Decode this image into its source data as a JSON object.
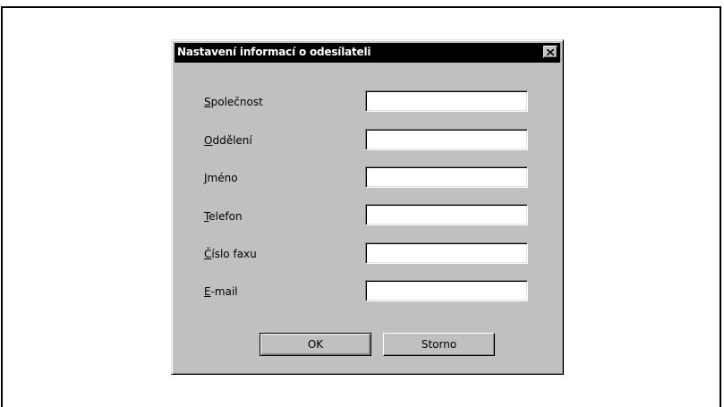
{
  "dialog": {
    "title": "Nastavení informací o odesílateli",
    "close_icon": "close-x-icon"
  },
  "fields": [
    {
      "label_accel": "S",
      "label_rest": "polečnost",
      "value": ""
    },
    {
      "label_accel": "O",
      "label_rest": "ddělení",
      "value": ""
    },
    {
      "label_accel": "J",
      "label_rest": "méno",
      "value": ""
    },
    {
      "label_accel": "T",
      "label_rest": "elefon",
      "value": ""
    },
    {
      "label_accel": "Č",
      "label_rest": "íslo faxu",
      "value": ""
    },
    {
      "label_accel": "E",
      "label_rest": "-mail",
      "value": ""
    }
  ],
  "buttons": {
    "ok_label": "OK",
    "cancel_label": "Storno"
  },
  "colors": {
    "dialog_face": "#c0c0c0",
    "titlebar": "#000000",
    "title_text": "#ffffff",
    "input_bg": "#ffffff"
  }
}
